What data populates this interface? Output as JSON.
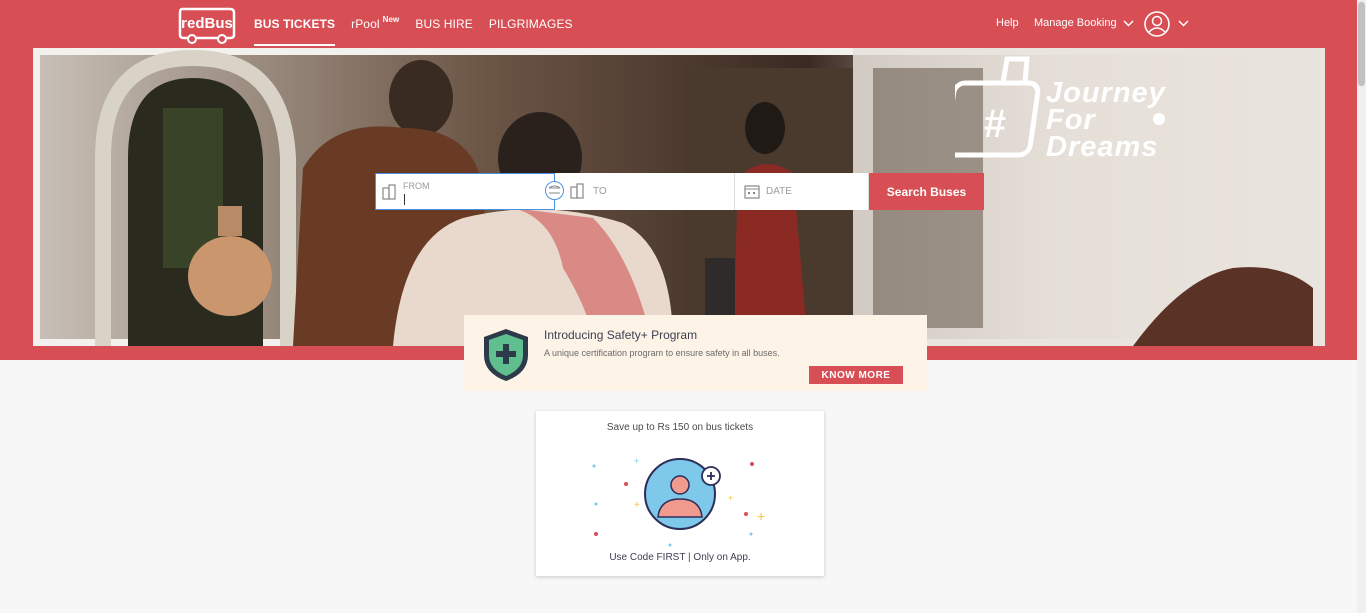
{
  "brand": {
    "logo_text": "redBus",
    "accent": "#d84e55"
  },
  "nav": {
    "items": [
      {
        "label": "BUS TICKETS",
        "active": true
      },
      {
        "label": "rPool",
        "badge": "New"
      },
      {
        "label": "BUS HIRE"
      },
      {
        "label": "PILGRIMAGES"
      }
    ],
    "help": "Help",
    "manage_booking": "Manage Booking"
  },
  "hero": {
    "tagline": [
      "Journey",
      "For",
      "Dreams"
    ]
  },
  "search": {
    "from_label": "FROM",
    "to_label": "TO",
    "date_label": "DATE",
    "button": "Search Buses"
  },
  "safety": {
    "title": "Introducing Safety+ Program",
    "desc": "A unique certification program to ensure safety in all buses.",
    "button": "KNOW MORE"
  },
  "offer": {
    "title": "Save up to Rs 150 on bus tickets",
    "code": "Use Code FIRST | Only on App."
  }
}
